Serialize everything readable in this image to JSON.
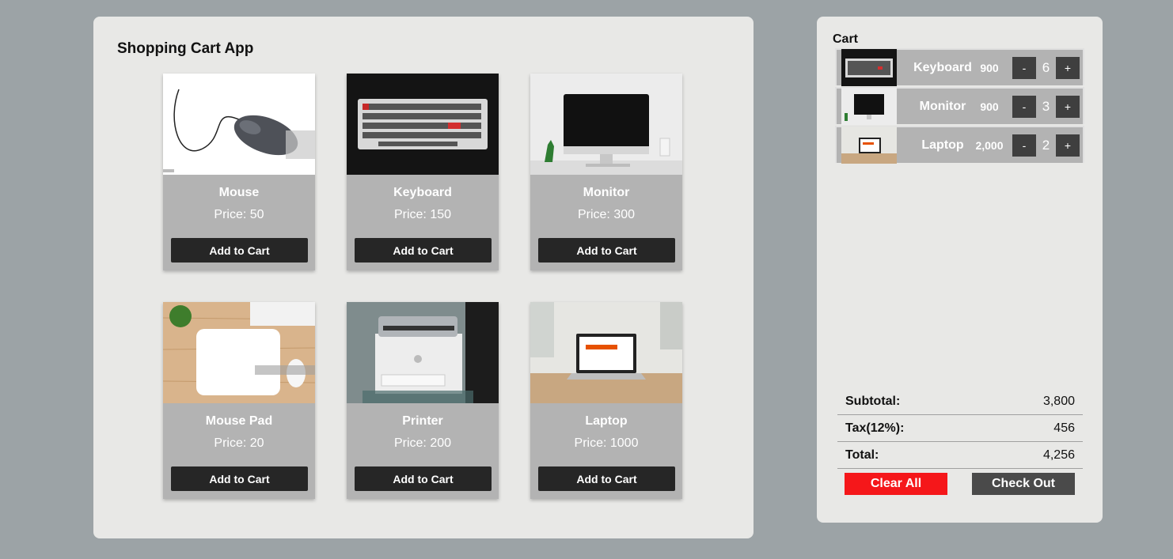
{
  "shop": {
    "title": "Shopping Cart App",
    "products": [
      {
        "name": "Mouse",
        "price": "Price: 50",
        "button": "Add to Cart",
        "image": "mouse-photo"
      },
      {
        "name": "Keyboard",
        "price": "Price: 150",
        "button": "Add to Cart",
        "image": "keyboard-photo"
      },
      {
        "name": "Monitor",
        "price": "Price: 300",
        "button": "Add to Cart",
        "image": "monitor-photo"
      },
      {
        "name": "Mouse Pad",
        "price": "Price: 20",
        "button": "Add to Cart",
        "image": "mousepad-photo"
      },
      {
        "name": "Printer",
        "price": "Price: 200",
        "button": "Add to Cart",
        "image": "printer-photo"
      },
      {
        "name": "Laptop",
        "price": "Price: 1000",
        "button": "Add to Cart",
        "image": "laptop-photo"
      }
    ]
  },
  "cart": {
    "title": "Cart",
    "items": [
      {
        "name": "Keyboard",
        "price": "900",
        "qty": "6",
        "minus": "-",
        "plus": "+"
      },
      {
        "name": "Monitor",
        "price": "900",
        "qty": "3",
        "minus": "-",
        "plus": "+"
      },
      {
        "name": "Laptop",
        "price": "2,000",
        "qty": "2",
        "minus": "-",
        "plus": "+"
      }
    ],
    "subtotal_label": "Subtotal:",
    "subtotal_value": "3,800",
    "tax_label": "Tax(12%):",
    "tax_value": "456",
    "total_label": "Total:",
    "total_value": "4,256",
    "clear_label": "Clear All",
    "checkout_label": "Check Out"
  },
  "colors": {
    "background": "#9ca3a6",
    "panel": "#e8e8e6",
    "card": "#b3b3b3",
    "button_dark": "#262626",
    "clear_red": "#f5171a",
    "checkout_gray": "#4a4a4a"
  }
}
